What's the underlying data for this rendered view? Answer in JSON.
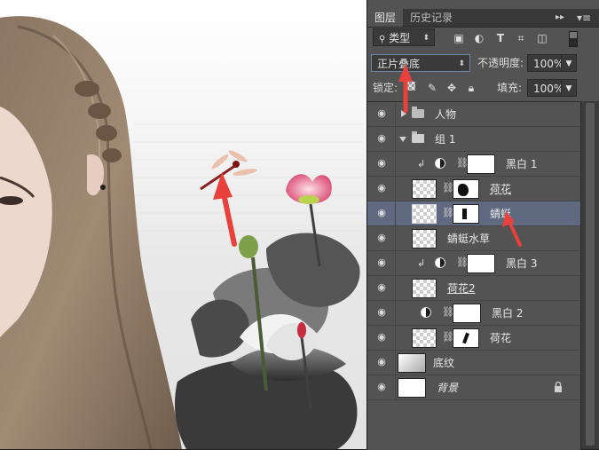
{
  "panel": {
    "tabs": [
      "图层",
      "历史记录"
    ],
    "menu_icon": "panel-menu-icon"
  },
  "filter": {
    "kind_label": "类型",
    "icons": [
      "image-filter-icon",
      "adjustment-filter-icon",
      "text-filter-icon",
      "shape-filter-icon",
      "smartobject-filter-icon"
    ]
  },
  "blend": {
    "mode": "正片叠底",
    "opacity_label": "不透明度:",
    "opacity_value": "100%"
  },
  "lock": {
    "label": "锁定:",
    "fill_label": "填充:",
    "fill_value": "100%"
  },
  "layers": [
    {
      "name": "人物",
      "type": "group-collapsed"
    },
    {
      "name": "组 1",
      "type": "group-expanded"
    },
    {
      "name": "黑白 1",
      "type": "adjustment",
      "clipped": true
    },
    {
      "name": "荷花",
      "type": "smart-mask",
      "style": "underline-dashed"
    },
    {
      "name": "蜻蜓",
      "type": "smart-mask",
      "selected": true
    },
    {
      "name": "蜻蜓水草",
      "type": "smart"
    },
    {
      "name": "黑白 3",
      "type": "adjustment",
      "clipped": true
    },
    {
      "name": "荷花2",
      "type": "smart",
      "style": "underline"
    },
    {
      "name": "黑白 2",
      "type": "adjustment"
    },
    {
      "name": "荷花",
      "type": "smart-mask"
    },
    {
      "name": "底纹",
      "type": "pixel"
    },
    {
      "name": "背景",
      "type": "background",
      "locked": true
    }
  ],
  "colors": {
    "panel_bg": "#535353",
    "selected_row": "#5f6a80",
    "annotation_arrow": "#e8403a"
  }
}
